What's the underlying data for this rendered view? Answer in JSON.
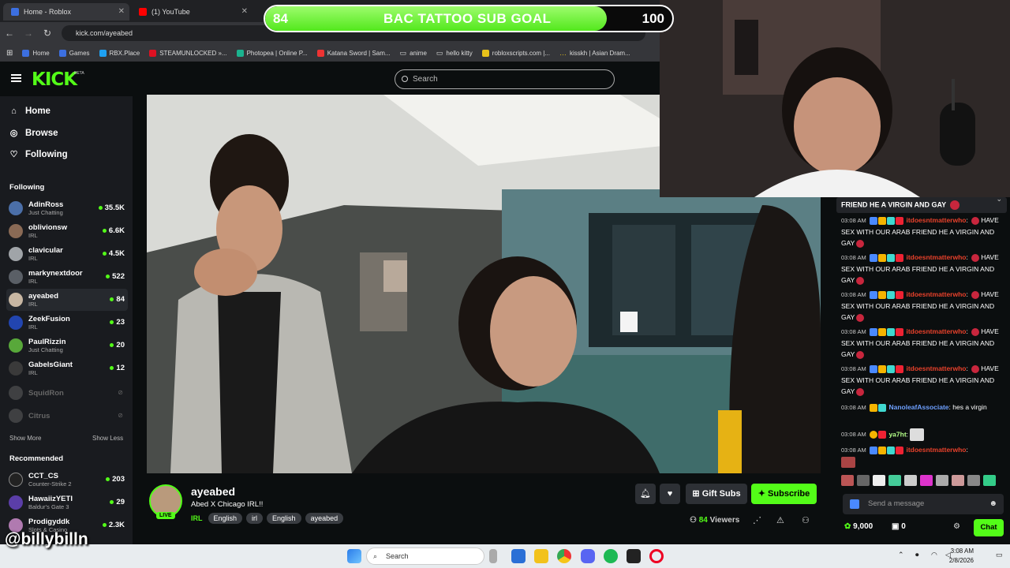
{
  "browser": {
    "tabs": [
      {
        "label": "Home - Roblox"
      },
      {
        "label": "(1) YouTube"
      }
    ],
    "url": "kick.com/ayeabed",
    "bookmarks": [
      "Home",
      "Games",
      "RBX.Place",
      "STEAMUNLOCKED »...",
      "Photopea | Online P...",
      "Katana Sword | Sam...",
      "anime",
      "hello kitty",
      "robloxscripts.com |...",
      "kisskh | Asian Dram..."
    ]
  },
  "goal": {
    "current": "84",
    "title": "BAC TATTOO SUB GOAL",
    "target": "100",
    "progress": 0.84
  },
  "header": {
    "logo": "KICK",
    "beta": "BETA",
    "search_placeholder": "Search"
  },
  "sidebar": {
    "nav": [
      {
        "label": "Home",
        "icon": "home-icon"
      },
      {
        "label": "Browse",
        "icon": "compass-icon"
      },
      {
        "label": "Following",
        "icon": "heart-icon"
      }
    ],
    "following_title": "Following",
    "following": [
      {
        "name": "AdinRoss",
        "category": "Just Chatting",
        "viewers": "35.5K",
        "color": "#4b6fa8"
      },
      {
        "name": "oblivionsw",
        "category": "IRL",
        "viewers": "6.6K",
        "color": "#8a6a55"
      },
      {
        "name": "clavicular",
        "category": "IRL",
        "viewers": "4.5K",
        "color": "#a0a4a8"
      },
      {
        "name": "markynextdoor",
        "category": "IRL",
        "viewers": "522",
        "color": "#5a5f66"
      },
      {
        "name": "ayeabed",
        "category": "IRL",
        "viewers": "84",
        "color": "#c8b7a3"
      },
      {
        "name": "ZeekFusion",
        "category": "IRL",
        "viewers": "23",
        "color": "#2245b0"
      },
      {
        "name": "PaulRizzin",
        "category": "Just Chatting",
        "viewers": "20",
        "color": "#58a83a"
      },
      {
        "name": "GabelsGiant",
        "category": "IRL",
        "viewers": "12",
        "color": "#3a3a3a"
      }
    ],
    "offline": [
      {
        "name": "SquidRon"
      },
      {
        "name": "Citrus"
      }
    ],
    "show_more": "Show More",
    "show_less": "Show Less",
    "recommended_title": "Recommended",
    "recommended": [
      {
        "name": "CCT_CS",
        "category": "Counter-Strike 2",
        "viewers": "203",
        "color": "#222"
      },
      {
        "name": "HawaiizYETI",
        "category": "Baldur's Gate 3",
        "viewers": "29",
        "color": "#5b3ea8"
      },
      {
        "name": "Prodigyddk",
        "category": "Slots & Casino",
        "viewers": "2.3K",
        "color": "#b07ab0"
      }
    ]
  },
  "stream": {
    "name": "ayeabed",
    "live": "LIVE",
    "title": "Abed X Chicago IRL!!",
    "category": "IRL",
    "tags": [
      "English",
      "irl",
      "English",
      "ayeabed"
    ],
    "gift_label": "Gift Subs",
    "subscribe_label": "Subscribe",
    "viewers": "84",
    "viewers_label": "Viewers"
  },
  "chat": {
    "pinned": "FRIEND HE A VIRGIN AND GAY",
    "messages": [
      {
        "time": "03:08 AM",
        "user": "itdoesntmatterwho",
        "text": "HAVE SEX WITH OUR ARAB FRIEND HE A VIRGIN AND GAY",
        "style": "red"
      },
      {
        "time": "03:08 AM",
        "user": "itdoesntmatterwho",
        "text": "HAVE SEX WITH OUR ARAB FRIEND HE A VIRGIN AND GAY",
        "style": "red"
      },
      {
        "time": "03:08 AM",
        "user": "itdoesntmatterwho",
        "text": "HAVE SEX WITH OUR ARAB FRIEND HE A VIRGIN AND GAY",
        "style": "red"
      },
      {
        "time": "03:08 AM",
        "user": "itdoesntmatterwho",
        "text": "HAVE SEX WITH OUR ARAB FRIEND HE A VIRGIN AND GAY",
        "style": "red"
      },
      {
        "time": "03:08 AM",
        "user": "itdoesntmatterwho",
        "text": "HAVE SEX WITH OUR ARAB FRIEND HE A VIRGIN AND GAY",
        "style": "red"
      },
      {
        "time": "03:08 AM",
        "user": "NanoleafAssociate",
        "text": "hes a virgin",
        "style": "blue"
      },
      {
        "time": "03:08 AM",
        "user": "ya7ht",
        "text": "",
        "style": "green"
      },
      {
        "time": "03:08 AM",
        "user": "itdoesntmatterwho",
        "text": "",
        "style": "red"
      }
    ],
    "input_placeholder": "Send a message",
    "points": "9,000",
    "subs": "0",
    "chat_button": "Chat"
  },
  "taskbar": {
    "search": "Search",
    "time": "3:08 AM",
    "date": "2/8/2026"
  },
  "watermark": "@billybilln"
}
